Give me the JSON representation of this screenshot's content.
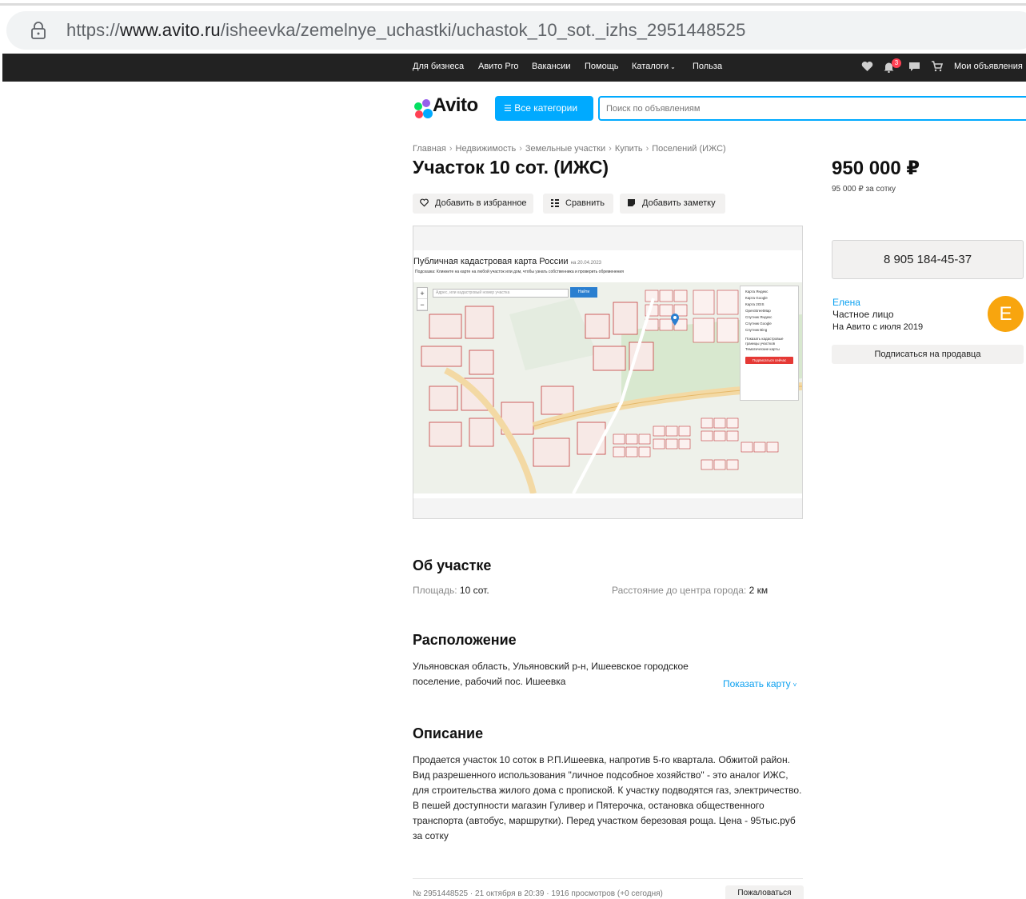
{
  "browser": {
    "url_scheme": "https://",
    "url_host": "www.avito.ru",
    "url_path": "/isheevka/zemelnye_uchastki/uchastok_10_sot._izhs_2951448525"
  },
  "topnav": {
    "links": [
      "Для бизнеса",
      "Авито Pro",
      "Вакансии",
      "Помощь",
      "Каталоги",
      "Польза"
    ],
    "notifications_badge": "3",
    "my_ads": "Мои объявления"
  },
  "header": {
    "logo": "Avito",
    "categories_button": "Все категории",
    "search_placeholder": "Поиск по объявлениям",
    "brand_color": "#00aaff"
  },
  "breadcrumb": [
    "Главная",
    "Недвижимость",
    "Земельные участки",
    "Купить",
    "Поселений (ИЖС)"
  ],
  "listing": {
    "title": "Участок 10 сот. (ИЖС)",
    "actions": {
      "favorite": "Добавить в избранное",
      "compare": "Сравнить",
      "note": "Добавить заметку"
    },
    "image": {
      "map_title": "Публичная кадастровая карта России",
      "map_date": "на 20.04.2023",
      "map_hint": "Подсказка: Кликните на карте на любой участок или дом, чтобы узнать собственника и проверить обременения",
      "search_placeholder": "Адрес, или кадастровый номер участка",
      "find_button": "Найти",
      "layers": [
        "Карта Яндекс",
        "Карта Google",
        "Карта 2GIS",
        "OpenStreetMap",
        "Спутник Яндекс",
        "Спутник Google",
        "Спутник Bing"
      ],
      "show_cadastral": "Показать кадастровые границы участков",
      "thematic": "Тематические карты",
      "subscribe_button": "Подписаться сейчас"
    }
  },
  "pricing": {
    "price": "950 000 ₽",
    "per_unit": "95 000 ₽ за сотку",
    "phone": "8 905 184-45-37"
  },
  "seller": {
    "name": "Елена",
    "type": "Частное лицо",
    "since": "На Авито с июля 2019",
    "avatar_letter": "Е",
    "avatar_color": "#f8a50e",
    "subscribe": "Подписаться на продавца"
  },
  "about": {
    "heading": "Об участке",
    "area_label": "Площадь:",
    "area_value": "10 сот.",
    "distance_label": "Расстояние до центра города:",
    "distance_value": "2 км"
  },
  "location": {
    "heading": "Расположение",
    "address": "Ульяновская область, Ульяновский р-н, Ишеевское городское поселение, рабочий пос. Ишеевка",
    "show_map": "Показать карту"
  },
  "description": {
    "heading": "Описание",
    "text": "Продается участок 10 соток в Р.П.Ишеевка, напротив 5-го квартала. Обжитой район. Вид разрешенного использования \"личное подсобное хозяйство\" - это аналог ИЖС, для строительства жилого дома с пропиской. К участку подводятся газ, электричество. В пешей доступности магазин Гуливер и Пятерочка, остановка общественного транспорта (автобус, маршрутки). Перед участком березовая роща. Цена - 95тыс.руб за сотку"
  },
  "footer": {
    "meta": "№ 2951448525 · 21 октября в 20:39 · 1916 просмотров (+0 сегодня)",
    "report": "Пожаловаться"
  }
}
